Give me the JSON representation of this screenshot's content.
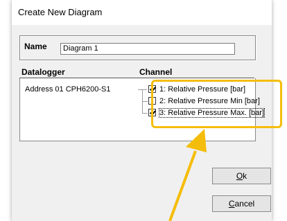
{
  "dialog": {
    "title": "Create New Diagram",
    "name_label": "Name",
    "name_value": "Diagram 1",
    "datalogger_header": "Datalogger",
    "channel_header": "Channel",
    "datalogger_entry": "Address 01 CPH6200-S1",
    "channels": [
      {
        "label": "1: Relative Pressure [bar]",
        "checked": true
      },
      {
        "label": "2: Relative Pressure Min [bar]",
        "checked": false
      },
      {
        "label": "3: Relative Pressure Max. [bar]",
        "checked": true
      }
    ],
    "ok_label": "Ok",
    "cancel_label": "Cancel"
  },
  "colors": {
    "highlight": "#f5bd0b"
  }
}
